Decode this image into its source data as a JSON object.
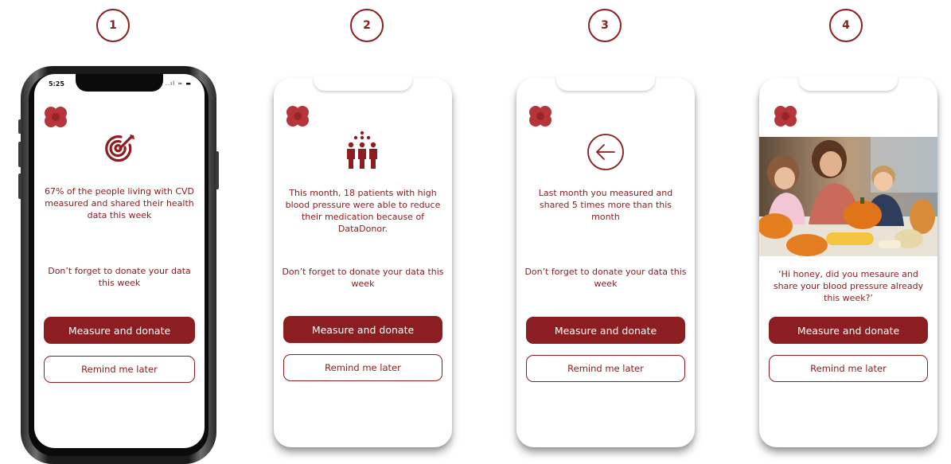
{
  "steps": [
    "1",
    "2",
    "3",
    "4"
  ],
  "status_bar": {
    "time": "5:25",
    "icons": "..ıl ≈ ▬"
  },
  "screens": [
    {
      "message": "67% of the people living with CVD measured and shared their health data this week",
      "reminder": "Don’t forget to donate your data this week",
      "primary_label": "Measure and donate",
      "secondary_label": "Remind me later",
      "icon": "target-icon"
    },
    {
      "message": "This month, 18 patients with high blood pressure were able to reduce their medication because of DataDonor.",
      "reminder": "Don’t forget to donate your data this week",
      "primary_label": "Measure and donate",
      "secondary_label": "Remind me later",
      "icon": "people-group-icon"
    },
    {
      "message": "Last month you measured and shared 5 times more than this month",
      "reminder": "Don’t forget to donate your data this week",
      "primary_label": "Measure and donate",
      "secondary_label": "Remind me later",
      "icon": "arrow-left-circle-icon"
    },
    {
      "message": "‘Hi honey, did you mesaure and share your blood pressure already this week?’",
      "primary_label": "Measure and donate",
      "secondary_label": "Remind me later",
      "photo": "family-pumpkin-carving-photo"
    }
  ],
  "colors": {
    "accent": "#8c1d21",
    "logo": "#b6353b"
  }
}
